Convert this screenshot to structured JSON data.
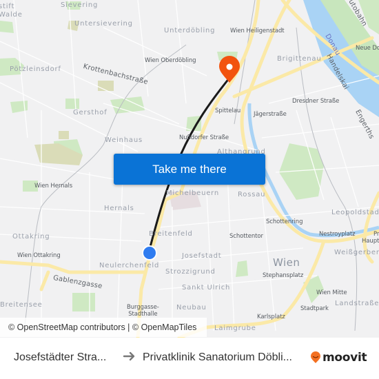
{
  "map": {
    "labels": {
      "stift_walde": "stift\nWalde",
      "sievering": "Sievering",
      "untersievering": "Untersievering",
      "unterdoebling": "Unterdöbling",
      "wien_heiligenstadt": "Wien Heiligenstadt",
      "poetzleinsdorf": "Pötzleinsdorf",
      "krottenbachstrasse": "Krottenbachstraße",
      "wien_oberdoebling": "Wien Oberdöbling",
      "brigittenau": "Brigittenau",
      "donau": "Donau",
      "handelskai": "Handelskai",
      "autobahn": "utobahn",
      "neue_donau": "Neue Do",
      "gersthof": "Gersthof",
      "spittelau": "Spittelau",
      "jaegerstrasse": "Jägerstraße",
      "dresdner_strasse": "Dresdner Straße",
      "engerthstrasse": "Engerths",
      "weinhaus": "Weinhaus",
      "nussdorfer_strasse": "Nußdorfer Straße",
      "alsergrund": "Althangrund",
      "wien_hernals": "Wien Hernals",
      "michelbeuern": "Michelbeuern",
      "rossau": "Rossau",
      "hernals": "Hernals",
      "leopoldstadt": "Leopoldstadt",
      "schottenring": "Schottenring",
      "ottakring": "Ottakring",
      "breitenfeld": "Breitenfeld",
      "schottentor": "Schottentor",
      "nestroyplatz": "Nestroyplatz",
      "praterstern": "Pr",
      "hauptbahnhof": "Haupt",
      "wien_ottakring": "Wien Ottakring",
      "josefstadt": "Josefstadt",
      "neulerchenfeld": "Neulerchenfeld",
      "weissgerber": "Weißgerber",
      "wien": "Wien",
      "strozzigrund": "Strozzigrund",
      "stephansplatz": "Stephansplatz",
      "gablenzgasse": "Gablenzgasse",
      "sankt_ulrich": "Sankt Ulrich",
      "wien_mitte": "Wien Mitte",
      "landstrasse": "Landstraße",
      "breitensee": "Breitensee",
      "burggasse": "Burggasse-\nStadthalle",
      "neubau": "Neubau",
      "stadtpark": "Stadtpark",
      "karlsplatz": "Karlsplatz",
      "laimgrube": "Laimgrube"
    },
    "route_color": "#1a1a1a",
    "origin_marker_color": "#2f7cf0",
    "destination_marker_color": "#f2530f"
  },
  "cta": {
    "label": "Take me there",
    "color": "#0a73d6"
  },
  "attribution": "© OpenStreetMap contributors | © OpenMapTiles",
  "footer": {
    "from": "Josefstädter Stra...",
    "to": "Privatklinik Sanatorium Döbli...",
    "brand": "moovit",
    "brand_color": "#f37021"
  }
}
